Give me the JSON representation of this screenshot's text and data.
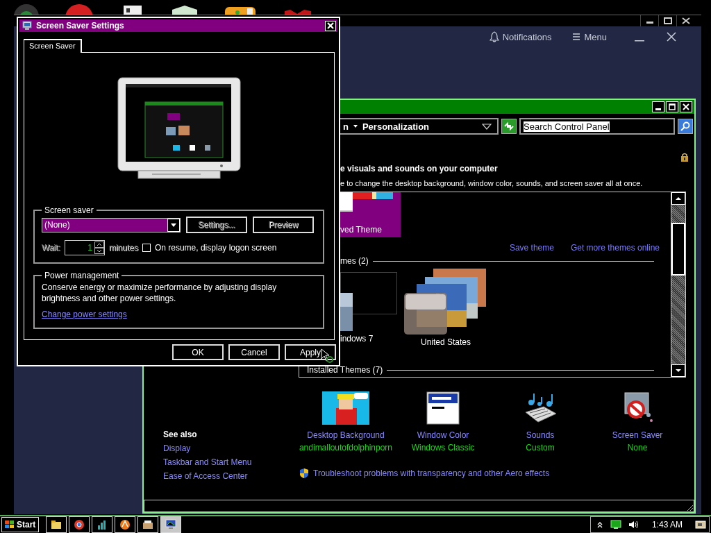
{
  "back_window": {
    "notifications": "Notifications",
    "menu": "Menu"
  },
  "control_panel": {
    "breadcrumb": [
      "n",
      "Personalization"
    ],
    "search": {
      "value": "Search Control Panel",
      "highlighted": true
    },
    "heading": "e visuals and sounds on your computer",
    "subheading": "e to change the desktop background, window color, sounds, and screen saver all at once.",
    "my_themes": [
      {
        "label": "ved Theme",
        "selected": true
      }
    ],
    "save_link": "Save theme",
    "more_link": "Get more themes online",
    "aero_heading": "mes (2)",
    "aero_themes": [
      {
        "label": "indows 7",
        "selected": false
      },
      {
        "label": "United States",
        "selected": false
      }
    ],
    "installed_heading": "Installed Themes (7)",
    "see_also": {
      "title": "See also",
      "links": [
        "Display",
        "Taskbar and Start Menu",
        "Ease of Access Center"
      ]
    },
    "settings": [
      {
        "kind": "background",
        "label": "Desktop Background",
        "value": "andimalloutofdolphinporn"
      },
      {
        "kind": "color",
        "label": "Window Color",
        "value": "Windows Classic"
      },
      {
        "kind": "sounds",
        "label": "Sounds",
        "value": "Custom"
      },
      {
        "kind": "saver",
        "label": "Screen Saver",
        "value": "None"
      }
    ],
    "troubleshoot": "Troubleshoot problems with transparency and other Aero effects"
  },
  "dialog": {
    "title": "Screen Saver Settings",
    "tabs": [
      {
        "label": "Screen Saver",
        "selected": true
      }
    ],
    "screen_saver": {
      "legend": "Screen saver",
      "dropdown": "(None)",
      "buttons": [
        {
          "label": "Settings...",
          "disabled": true
        },
        {
          "label": "Preview",
          "disabled": true
        }
      ],
      "wait": {
        "label": "Wait:",
        "value": "1",
        "unit": "minutes",
        "disabled": true
      },
      "logon": {
        "label": "On resume, display logon screen",
        "checked": false
      }
    },
    "power": {
      "legend": "Power management",
      "text": "Conserve energy or maximize performance by adjusting display brightness and other power settings.",
      "link": "Change power settings"
    },
    "buttons": [
      {
        "label": "OK"
      },
      {
        "label": "Cancel"
      },
      {
        "label": "Apply"
      }
    ]
  },
  "taskbar": {
    "start": "Start",
    "clock": "1:43 AM",
    "buttons": [
      {
        "kind": "folder",
        "selected": false
      },
      {
        "kind": "browser",
        "selected": false
      },
      {
        "kind": "chart",
        "selected": false
      },
      {
        "kind": "disc",
        "selected": false
      },
      {
        "kind": "scanner",
        "selected": false
      },
      {
        "kind": "monitor",
        "selected": true
      }
    ]
  }
}
